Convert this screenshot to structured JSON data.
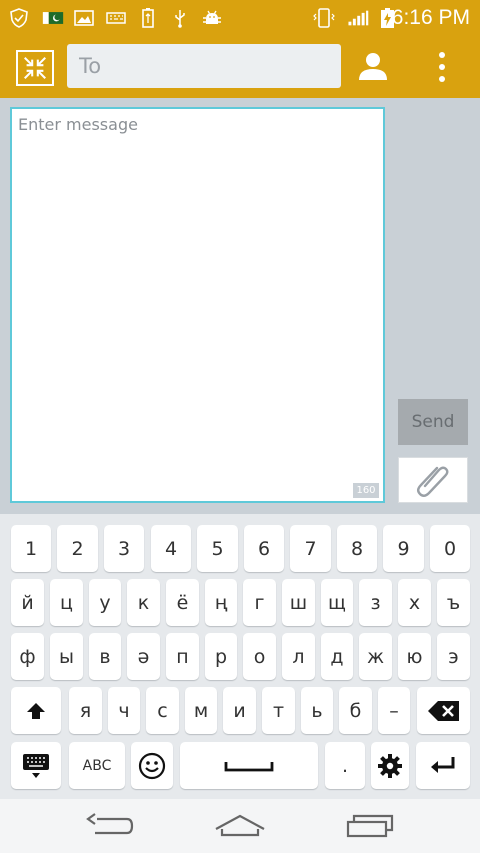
{
  "status_bar": {
    "time": "6:16 PM",
    "left_icons": [
      "shield-check-icon",
      "pakistan-flag-icon",
      "image-icon",
      "keyboard-icon",
      "battery-usb-icon",
      "usb-icon",
      "android-debug-icon"
    ],
    "right_icons": [
      "vibrate-icon",
      "signal-icon",
      "battery-charging-icon"
    ]
  },
  "toolbar": {
    "to_placeholder": "To",
    "contact_picker_icon": "collapse-arrows-icon",
    "person_icon": "person-icon",
    "menu_icon": "overflow-menu-icon"
  },
  "composer": {
    "message_placeholder": "Enter message",
    "char_count": "160",
    "send_label": "Send",
    "attach_icon": "paperclip-icon"
  },
  "keyboard": {
    "row1": [
      "1",
      "2",
      "3",
      "4",
      "5",
      "6",
      "7",
      "8",
      "9",
      "0"
    ],
    "row2": [
      "й",
      "ц",
      "у",
      "к",
      "ё",
      "ң",
      "г",
      "ш",
      "щ",
      "з",
      "х",
      "ъ"
    ],
    "row3": [
      "ф",
      "ы",
      "в",
      "ә",
      "п",
      "р",
      "о",
      "л",
      "д",
      "ж",
      "ю",
      "э"
    ],
    "row4": [
      "я",
      "ч",
      "с",
      "м",
      "и",
      "т",
      "ь",
      "б",
      "–"
    ],
    "abc_label": "ABC",
    "period_label": ".",
    "icons": [
      "shift-icon",
      "backspace-icon",
      "keyboard-settings-icon",
      "emoji-icon",
      "space-icon",
      "gear-icon",
      "enter-icon"
    ]
  },
  "nav_bar": {
    "icons": [
      "back-icon",
      "home-icon",
      "recents-icon"
    ]
  }
}
